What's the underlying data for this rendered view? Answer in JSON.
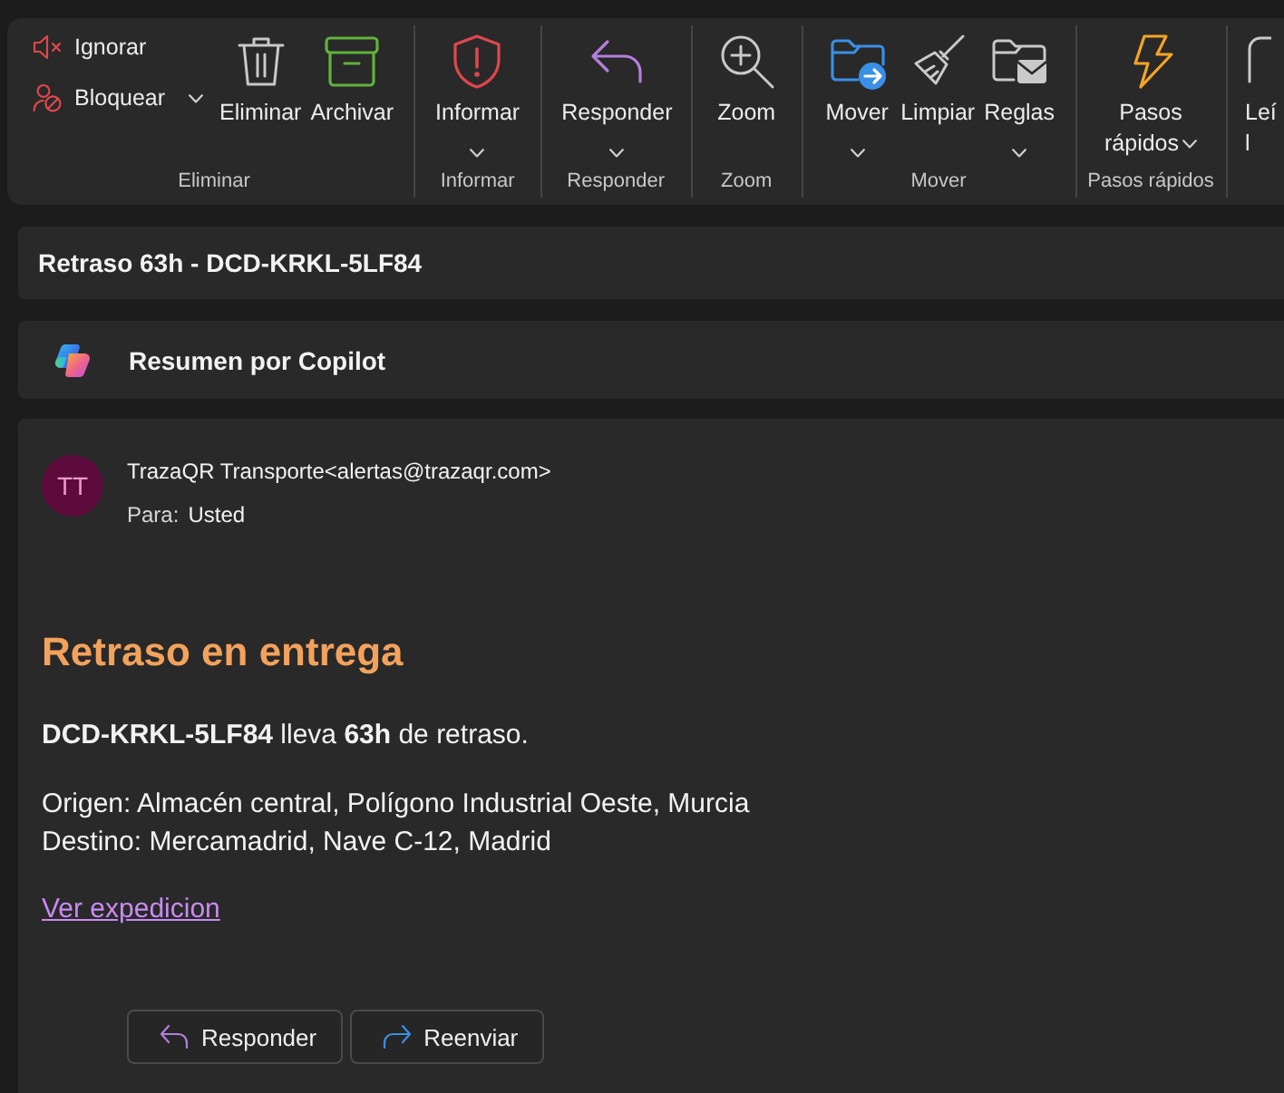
{
  "ribbon": {
    "groups": [
      {
        "label": "Eliminar",
        "small_buttons": [
          {
            "label": "Ignorar",
            "kind": "ignore",
            "dropdown": false
          },
          {
            "label": "Bloquear",
            "kind": "block",
            "dropdown": true
          }
        ],
        "buttons": [
          {
            "label": "Eliminar",
            "kind": "delete",
            "dropdown": false
          },
          {
            "label": "Archivar",
            "kind": "archive",
            "dropdown": false
          }
        ]
      },
      {
        "label": "Informar",
        "buttons": [
          {
            "label": "Informar",
            "kind": "report",
            "dropdown": true
          }
        ]
      },
      {
        "label": "Responder",
        "buttons": [
          {
            "label": "Responder",
            "kind": "reply",
            "dropdown": true
          }
        ]
      },
      {
        "label": "Zoom",
        "buttons": [
          {
            "label": "Zoom",
            "kind": "zoom",
            "dropdown": false
          }
        ]
      },
      {
        "label": "Mover",
        "buttons": [
          {
            "label": "Mover",
            "kind": "move",
            "dropdown": true
          },
          {
            "label": "Limpiar",
            "kind": "sweep",
            "dropdown": false
          },
          {
            "label": "Reglas",
            "kind": "rules",
            "dropdown": true
          }
        ]
      },
      {
        "label": "Pasos rápidos",
        "buttons": [
          {
            "label": "Pasos rápidos",
            "kind": "quick-steps",
            "dropdown": true
          }
        ]
      },
      {
        "buttons": [
          {
            "label": "Leí\nl",
            "kind": "read",
            "dropdown": false
          }
        ]
      }
    ]
  },
  "subject": "Retraso 63h - DCD-KRKL-5LF84",
  "copilot": {
    "label": "Resumen por Copilot"
  },
  "message": {
    "initials": "TT",
    "sender": "TrazaQR Transporte<alertas@trazaqr.com>",
    "to_label": "Para:",
    "to": "Usted",
    "heading": "Retraso en entrega",
    "summary": "**DCD-KRKL-5LF84** lleva **63h** de retraso.",
    "route": [
      "Origen: Almacén central, Polígono Industrial Oeste, Murcia",
      "Destino: Mercamadrid, Nave C-12, Madrid"
    ],
    "link": "Ver expedicion",
    "actions": [
      {
        "label": "Responder",
        "kind": "reply"
      },
      {
        "label": "Reenviar",
        "kind": "forward"
      }
    ]
  }
}
